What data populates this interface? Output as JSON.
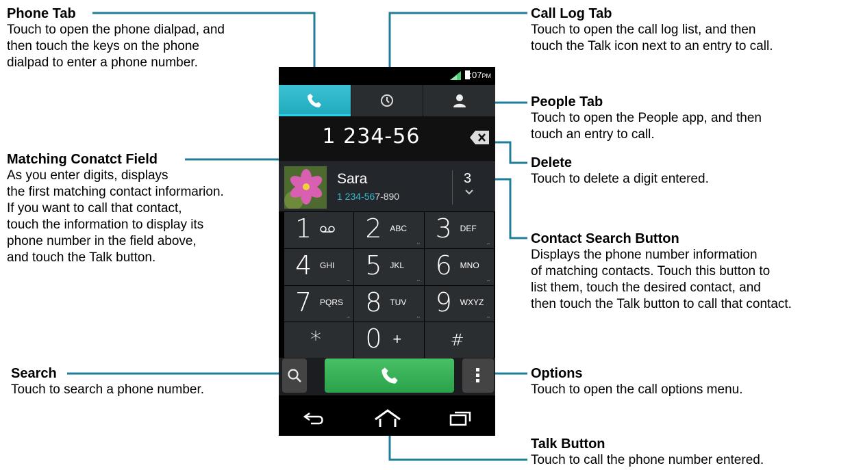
{
  "annotations": {
    "phone_tab": {
      "title": "Phone Tab",
      "desc": "Touch to open the phone dialpad, and\nthen touch the keys on the phone\ndialpad to enter a phone number."
    },
    "call_log_tab": {
      "title": "Call Log Tab",
      "desc": "Touch to open the call log list, and then\ntouch the Talk icon next to an entry to call."
    },
    "people_tab": {
      "title": "People Tab",
      "desc": "Touch to open the People app, and then\ntouch an entry to call."
    },
    "matching_contact": {
      "title": "Matching Conatct Field",
      "desc": "As you enter digits, displays\nthe first matching contact informarion.\nIf you want to call that contact,\ntouch the information to display its\nphone number in the field above,\nand touch the Talk button."
    },
    "delete": {
      "title": "Delete",
      "desc": "Touch to delete a digit entered."
    },
    "contact_search": {
      "title": "Contact Search Button",
      "desc": "Displays the phone number information\nof matching contacts. Touch this button to\nlist them, touch the desired contact, and\nthen touch the Talk button to call that contact."
    },
    "search": {
      "title": "Search",
      "desc": "Touch to search a phone number."
    },
    "options": {
      "title": "Options",
      "desc": "Touch to open the call options menu."
    },
    "talk": {
      "title": "Talk Button",
      "desc": "Touch to call the phone number entered."
    }
  },
  "phone": {
    "status_time": "9:07",
    "status_ampm": "PM",
    "dial_number": "1 234-56",
    "contact": {
      "name": "Sara",
      "number_match": "1 234-56",
      "number_rest": "7-890",
      "match_count": "3"
    },
    "keys": [
      {
        "digit": "1",
        "letters": "",
        "icon": "voicemail-icon"
      },
      {
        "digit": "2",
        "letters": "ABC"
      },
      {
        "digit": "3",
        "letters": "DEF"
      },
      {
        "digit": "4",
        "letters": "GHI"
      },
      {
        "digit": "5",
        "letters": "JKL"
      },
      {
        "digit": "6",
        "letters": "MNO"
      },
      {
        "digit": "7",
        "letters": "PQRS"
      },
      {
        "digit": "8",
        "letters": "TUV"
      },
      {
        "digit": "9",
        "letters": "WXYZ"
      },
      {
        "digit": "*",
        "letters": ""
      },
      {
        "digit": "0",
        "letters": "+"
      },
      {
        "digit": "#",
        "letters": ""
      }
    ],
    "key_dots": "...",
    "colors": {
      "accent": "#2aa7b8",
      "talk": "#34b057",
      "line": "#1f7d99"
    }
  }
}
